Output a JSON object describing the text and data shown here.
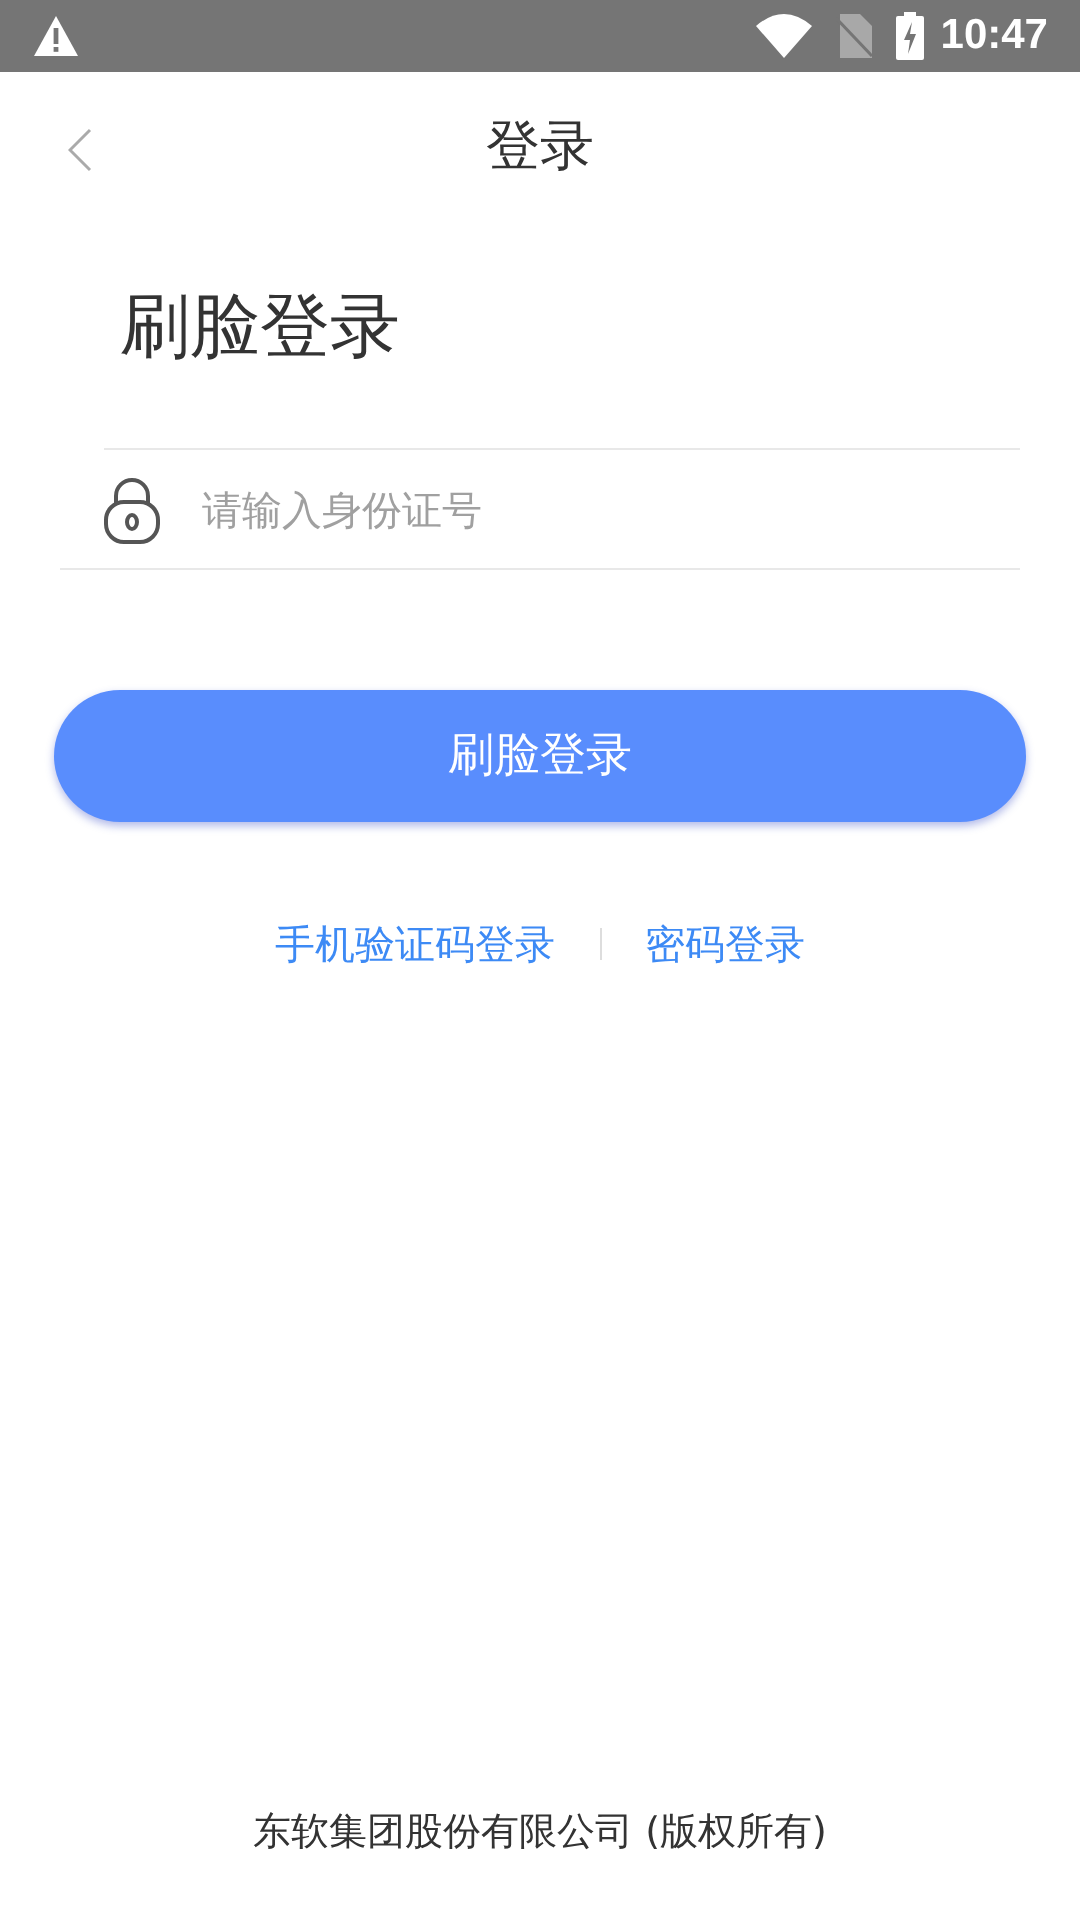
{
  "status_bar": {
    "time": "10:47"
  },
  "header": {
    "title": "登录"
  },
  "heading": "刷脸登录",
  "id_field": {
    "placeholder": "请输入身份证号"
  },
  "submit_button": "刷脸登录",
  "alt_links": [
    "手机验证码登录",
    "密码登录"
  ],
  "footer": "东软集团股份有限公司 (版权所有)"
}
